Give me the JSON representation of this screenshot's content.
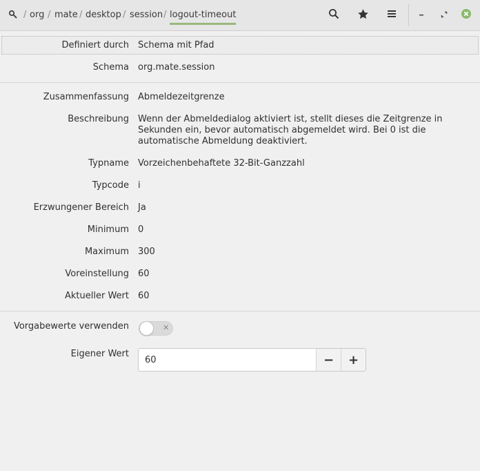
{
  "breadcrumb": {
    "items": [
      "org",
      "mate",
      "desktop",
      "session",
      "logout-timeout"
    ],
    "separator": "/"
  },
  "header": {
    "search_icon": "search-icon",
    "bookmark_icon": "star-icon",
    "menu_icon": "hamburger-menu-icon"
  },
  "fields": {
    "defined_by": {
      "label": "Definiert durch",
      "value": "Schema mit Pfad"
    },
    "schema": {
      "label": "Schema",
      "value": "org.mate.session"
    },
    "summary": {
      "label": "Zusammenfassung",
      "value": "Abmeldezeitgrenze"
    },
    "description": {
      "label": "Beschreibung",
      "value": "Wenn der Abmeldedialog aktiviert ist, stellt dieses die Zeitgrenze in Sekunden ein, bevor automatisch abgemeldet wird. Bei 0 ist die automatische Abmeldung deaktiviert."
    },
    "type_name": {
      "label": "Typname",
      "value": "Vorzeichenbehaftete 32-Bit-Ganzzahl"
    },
    "type_code": {
      "label": "Typcode",
      "value": "i"
    },
    "forced_range": {
      "label": "Erzwungener Bereich",
      "value": "Ja"
    },
    "minimum": {
      "label": "Minimum",
      "value": "0"
    },
    "maximum": {
      "label": "Maximum",
      "value": "300"
    },
    "default": {
      "label": "Voreinstellung",
      "value": "60"
    },
    "current": {
      "label": "Aktueller Wert",
      "value": "60"
    }
  },
  "controls": {
    "use_default_label": "Vorgabewerte verwenden",
    "use_default_on": false,
    "custom_value_label": "Eigener Wert",
    "custom_value": "60",
    "minus_label": "−",
    "plus_label": "+"
  },
  "colors": {
    "accent": "#9ab87c",
    "close_button": "#8ab96a"
  }
}
